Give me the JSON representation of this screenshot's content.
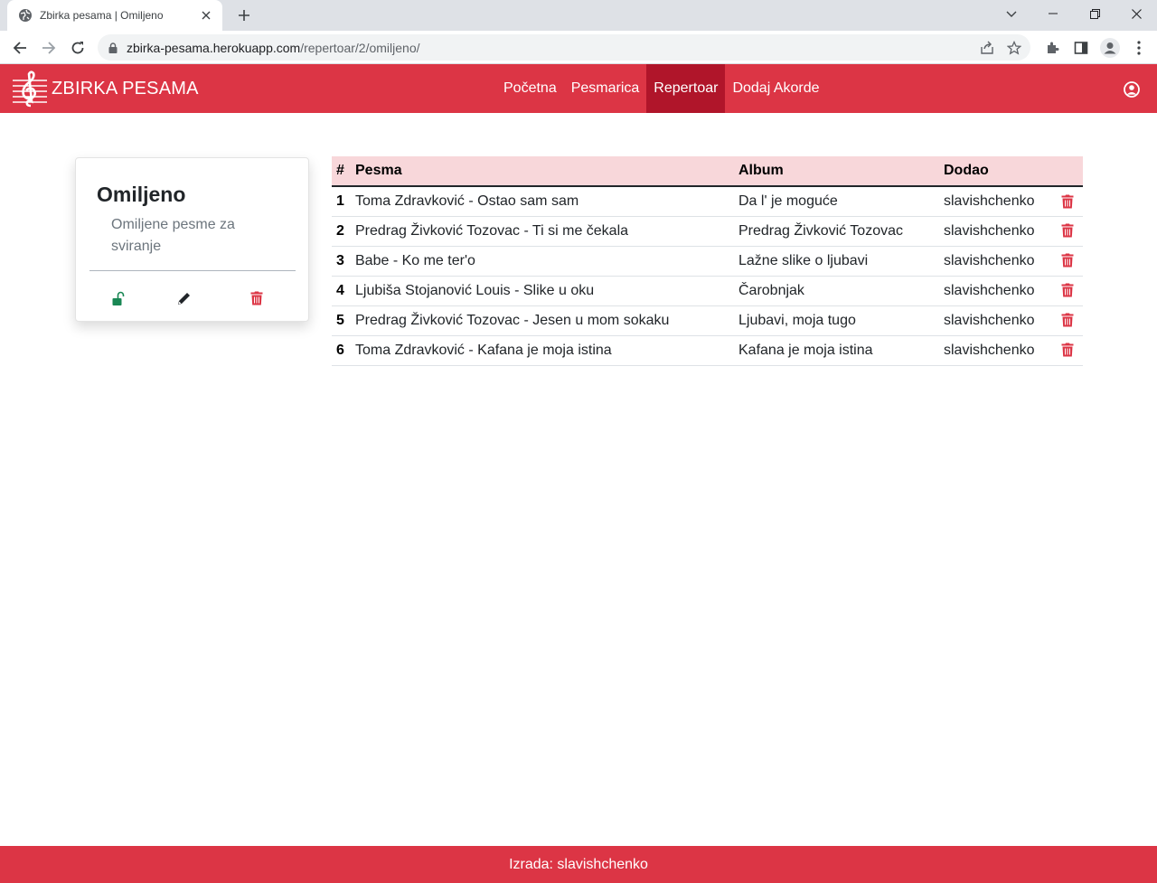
{
  "browser": {
    "tab_title": "Zbirka pesama | Omiljeno",
    "url_host": "zbirka-pesama.herokuapp.com",
    "url_path": "/repertoar/2/omiljeno/"
  },
  "navbar": {
    "brand": "ZBIRKA PESAMA",
    "links": [
      {
        "label": "Početna"
      },
      {
        "label": "Pesmarica"
      },
      {
        "label": "Repertoar",
        "active": true
      },
      {
        "label": "Dodaj Akorde"
      }
    ],
    "accent_color": "#dc3545",
    "active_color": "#b0152a"
  },
  "card": {
    "title": "Omiljeno",
    "description": "Omiljene pesme za sviranje",
    "actions": [
      "unlock-icon",
      "pencil-icon",
      "trash-icon"
    ]
  },
  "table": {
    "headers": {
      "num": "#",
      "song": "Pesma",
      "album": "Album",
      "user": "Dodao"
    },
    "rows": [
      {
        "num": "1",
        "song": "Toma Zdravković - Ostao sam sam",
        "album": "Da l' je moguće",
        "user": "slavishchenko"
      },
      {
        "num": "2",
        "song": "Predrag Živković Tozovac - Ti si me čekala",
        "album": "Predrag Živković Tozovac",
        "user": "slavishchenko"
      },
      {
        "num": "3",
        "song": "Babe - Ko me ter'o",
        "album": "Lažne slike o ljubavi",
        "user": "slavishchenko"
      },
      {
        "num": "4",
        "song": "Ljubiša Stojanović Louis - Slike u oku",
        "album": "Čarobnjak",
        "user": "slavishchenko"
      },
      {
        "num": "5",
        "song": "Predrag Živković Tozovac - Jesen u mom sokaku",
        "album": "Ljubavi, moja tugo",
        "user": "slavishchenko"
      },
      {
        "num": "6",
        "song": "Toma Zdravković - Kafana je moja istina",
        "album": "Kafana je moja istina",
        "user": "slavishchenko"
      }
    ]
  },
  "footer": {
    "text": "Izrada: slavishchenko"
  }
}
